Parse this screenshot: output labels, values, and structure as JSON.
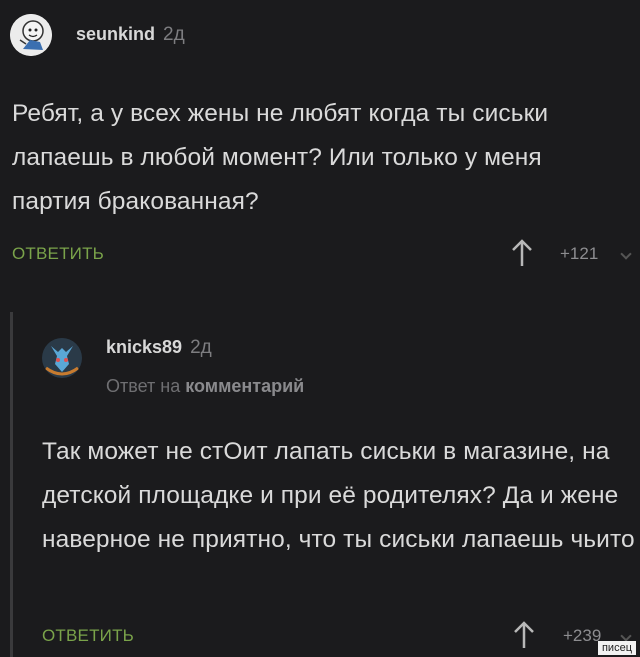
{
  "comment1": {
    "author": "seunkind",
    "time": "2д",
    "text": "Ребят, а у всех жены не любят когда ты сиськи лапаешь в любой момент? Или только у меня партия бракованная?",
    "reply_label": "ОТВЕТИТЬ",
    "score": "+121"
  },
  "comment2": {
    "author": "knicks89",
    "time": "2д",
    "reply_to_prefix": "Ответ на",
    "reply_to_target": "комментарий",
    "text": "Так может не стОит лапать сиськи в магазине, на детской площадке и при её родителях? Да и жене наверное не приятно, что ты сиськи лапаешь чьито",
    "reply_label": "ОТВЕТИТЬ",
    "score": "+239"
  },
  "watermark": "писец",
  "colors": {
    "background": "#1b1b1d",
    "accent_green": "#7aa34a",
    "muted": "#7d7d80"
  },
  "icons": [
    "upvote-arrow-icon",
    "collapse-chevron-icon",
    "avatar-icon"
  ]
}
